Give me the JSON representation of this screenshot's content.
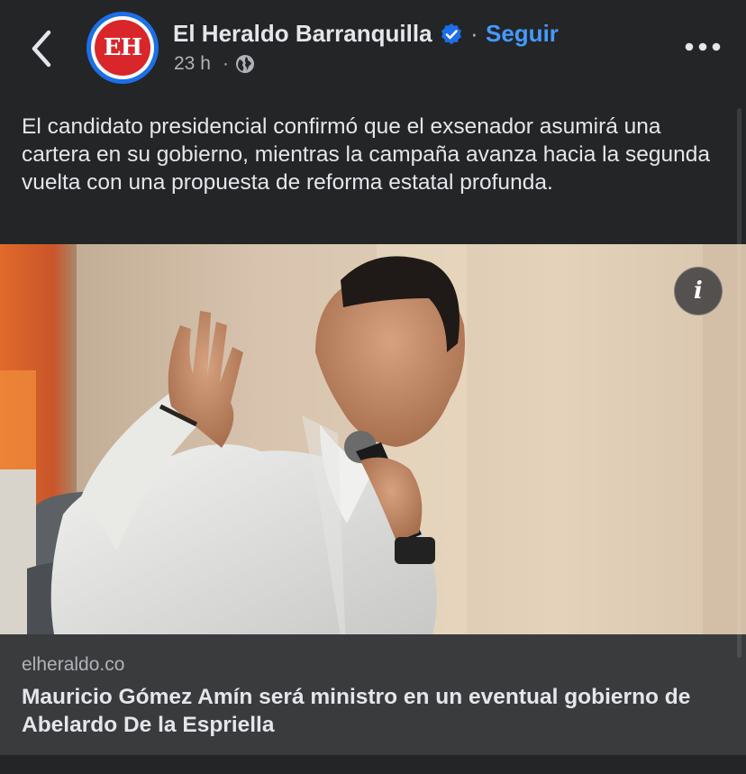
{
  "post": {
    "page_name": "El Heraldo Barranquilla",
    "avatar_text": "EH",
    "separator": "·",
    "follow_label": "Seguir",
    "time": "23 h",
    "time_separator": "·",
    "privacy_icon": "globe-icon",
    "caption": "El candidato presidencial confirmó que el exsenador asumirá una cartera en su gobierno, mientras la campaña avanza hacia la segunda vuelta con una propuesta de reforma estatal profunda."
  },
  "photo": {
    "info_label": "i"
  },
  "link": {
    "domain": "elheraldo.co",
    "title": "Mauricio Gómez Amín será ministro en un eventual gobierno de Abelardo De la Espriella"
  },
  "colors": {
    "background": "#242526",
    "accent": "#4599ff",
    "verified": "#1c6fe8",
    "brand_red": "#d9262b",
    "card": "#3a3b3c"
  }
}
